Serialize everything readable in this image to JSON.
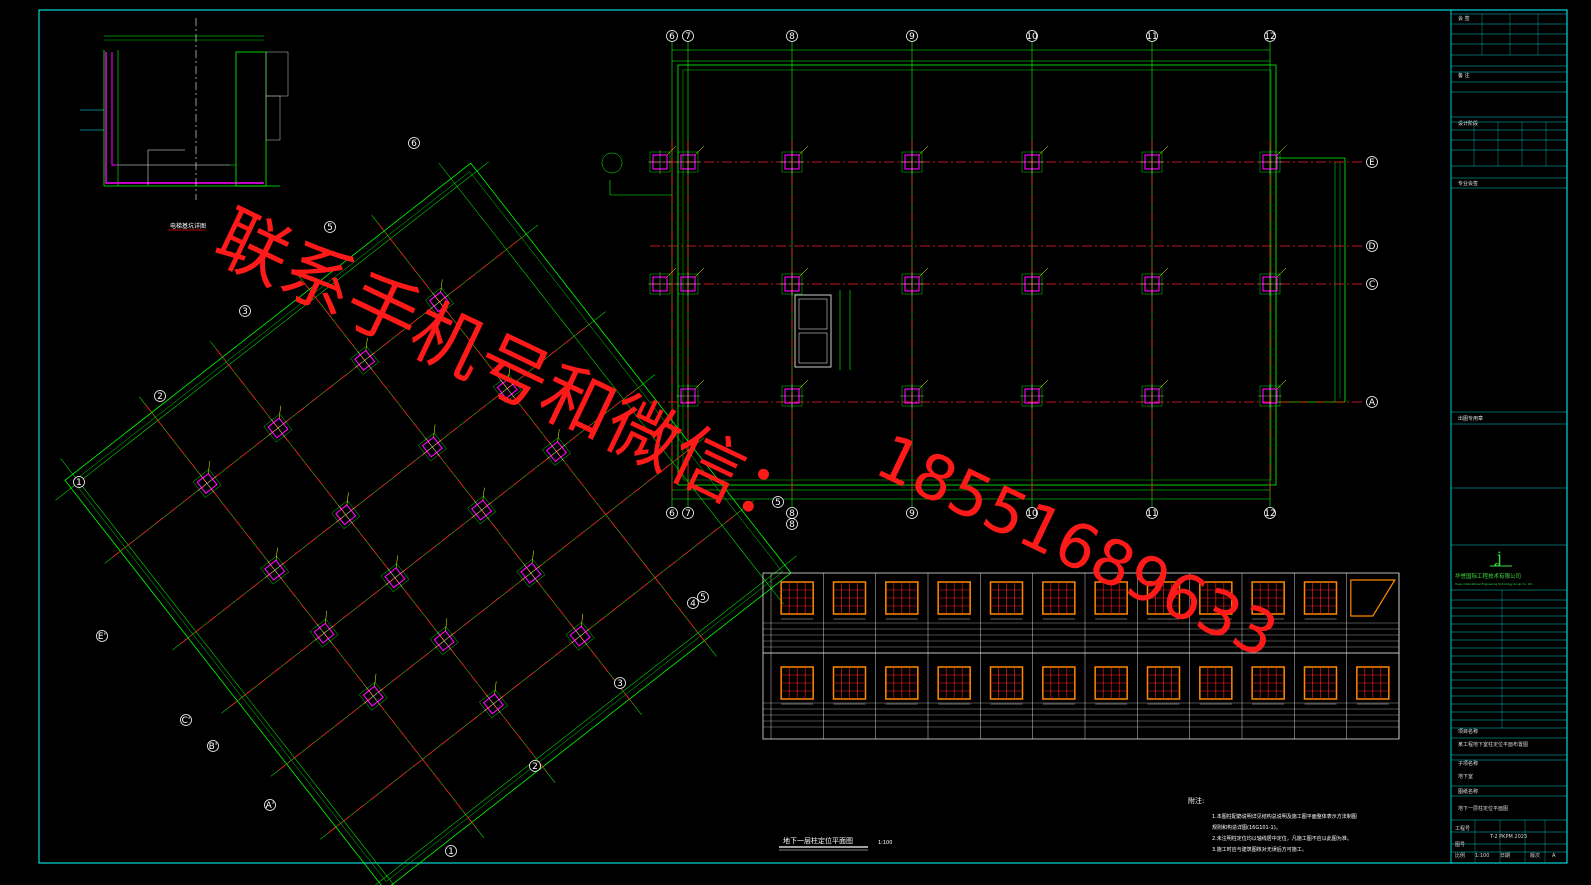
{
  "drawing": {
    "main_title": "地下一层柱定位平面图",
    "scale": "1:100",
    "detail_label": "电梯基坑详图",
    "notes_title": "附注:",
    "notes": [
      "1.本图柱配筋说明详见结构总说明及施工图平面整体表示方法制图",
      "  规则和构造详图(16G101-1)。",
      "2.未注明柱定位均以轴线居中定位，凡施工图不应以此图为准。",
      "3.施工时应与建筑图核对无误后方可施工。"
    ]
  },
  "axes": {
    "rect_top": [
      "6",
      "7",
      "8",
      "9",
      "10",
      "11",
      "12"
    ],
    "rect_bottom": [
      "6",
      "7",
      "8",
      "9",
      "10",
      "11",
      "12"
    ],
    "rect_right": [
      "E",
      "D",
      "C",
      "A"
    ],
    "rot_ne": [
      "1",
      "2",
      "3",
      "4",
      "5",
      "6"
    ],
    "rot_sw": [
      "1",
      "2",
      "3",
      "4",
      "5"
    ],
    "rot_nw": [
      "E'",
      "C'",
      "B'",
      "A'"
    ],
    "rot_left_side": [
      "1",
      "2",
      "3",
      "5"
    ]
  },
  "title_block": {
    "company": "华誉国际工程技术有限公司",
    "company_en": "Huayu International Engineering Technology Group Co., Ltd.",
    "sections": [
      "会 签",
      "备 注",
      "设计阶段",
      "专业会签",
      "出图专用章",
      "项目名称",
      "子项名称",
      "图纸名称"
    ],
    "project_name": "某工程地下室柱定位平面布置图",
    "sub_project": "地下室",
    "drawing_name": "地下一层柱定位平面图",
    "drawing_no": "T-2 PKPM 2023",
    "labels": [
      "工程号",
      "图号",
      "比例",
      "日期",
      "版次"
    ],
    "scale_value": "1:100",
    "edition": "A"
  },
  "watermark": {
    "line1": "联系手机号和微信：",
    "line2": "18551689633"
  },
  "colors": {
    "grid": "#00ff00",
    "axis_red": "#ff2020",
    "column": "#ff00ff",
    "text": "#ffffff",
    "frame": "#00ffff",
    "watermark": "#ff1a1a",
    "rebar": "#ff8800"
  }
}
